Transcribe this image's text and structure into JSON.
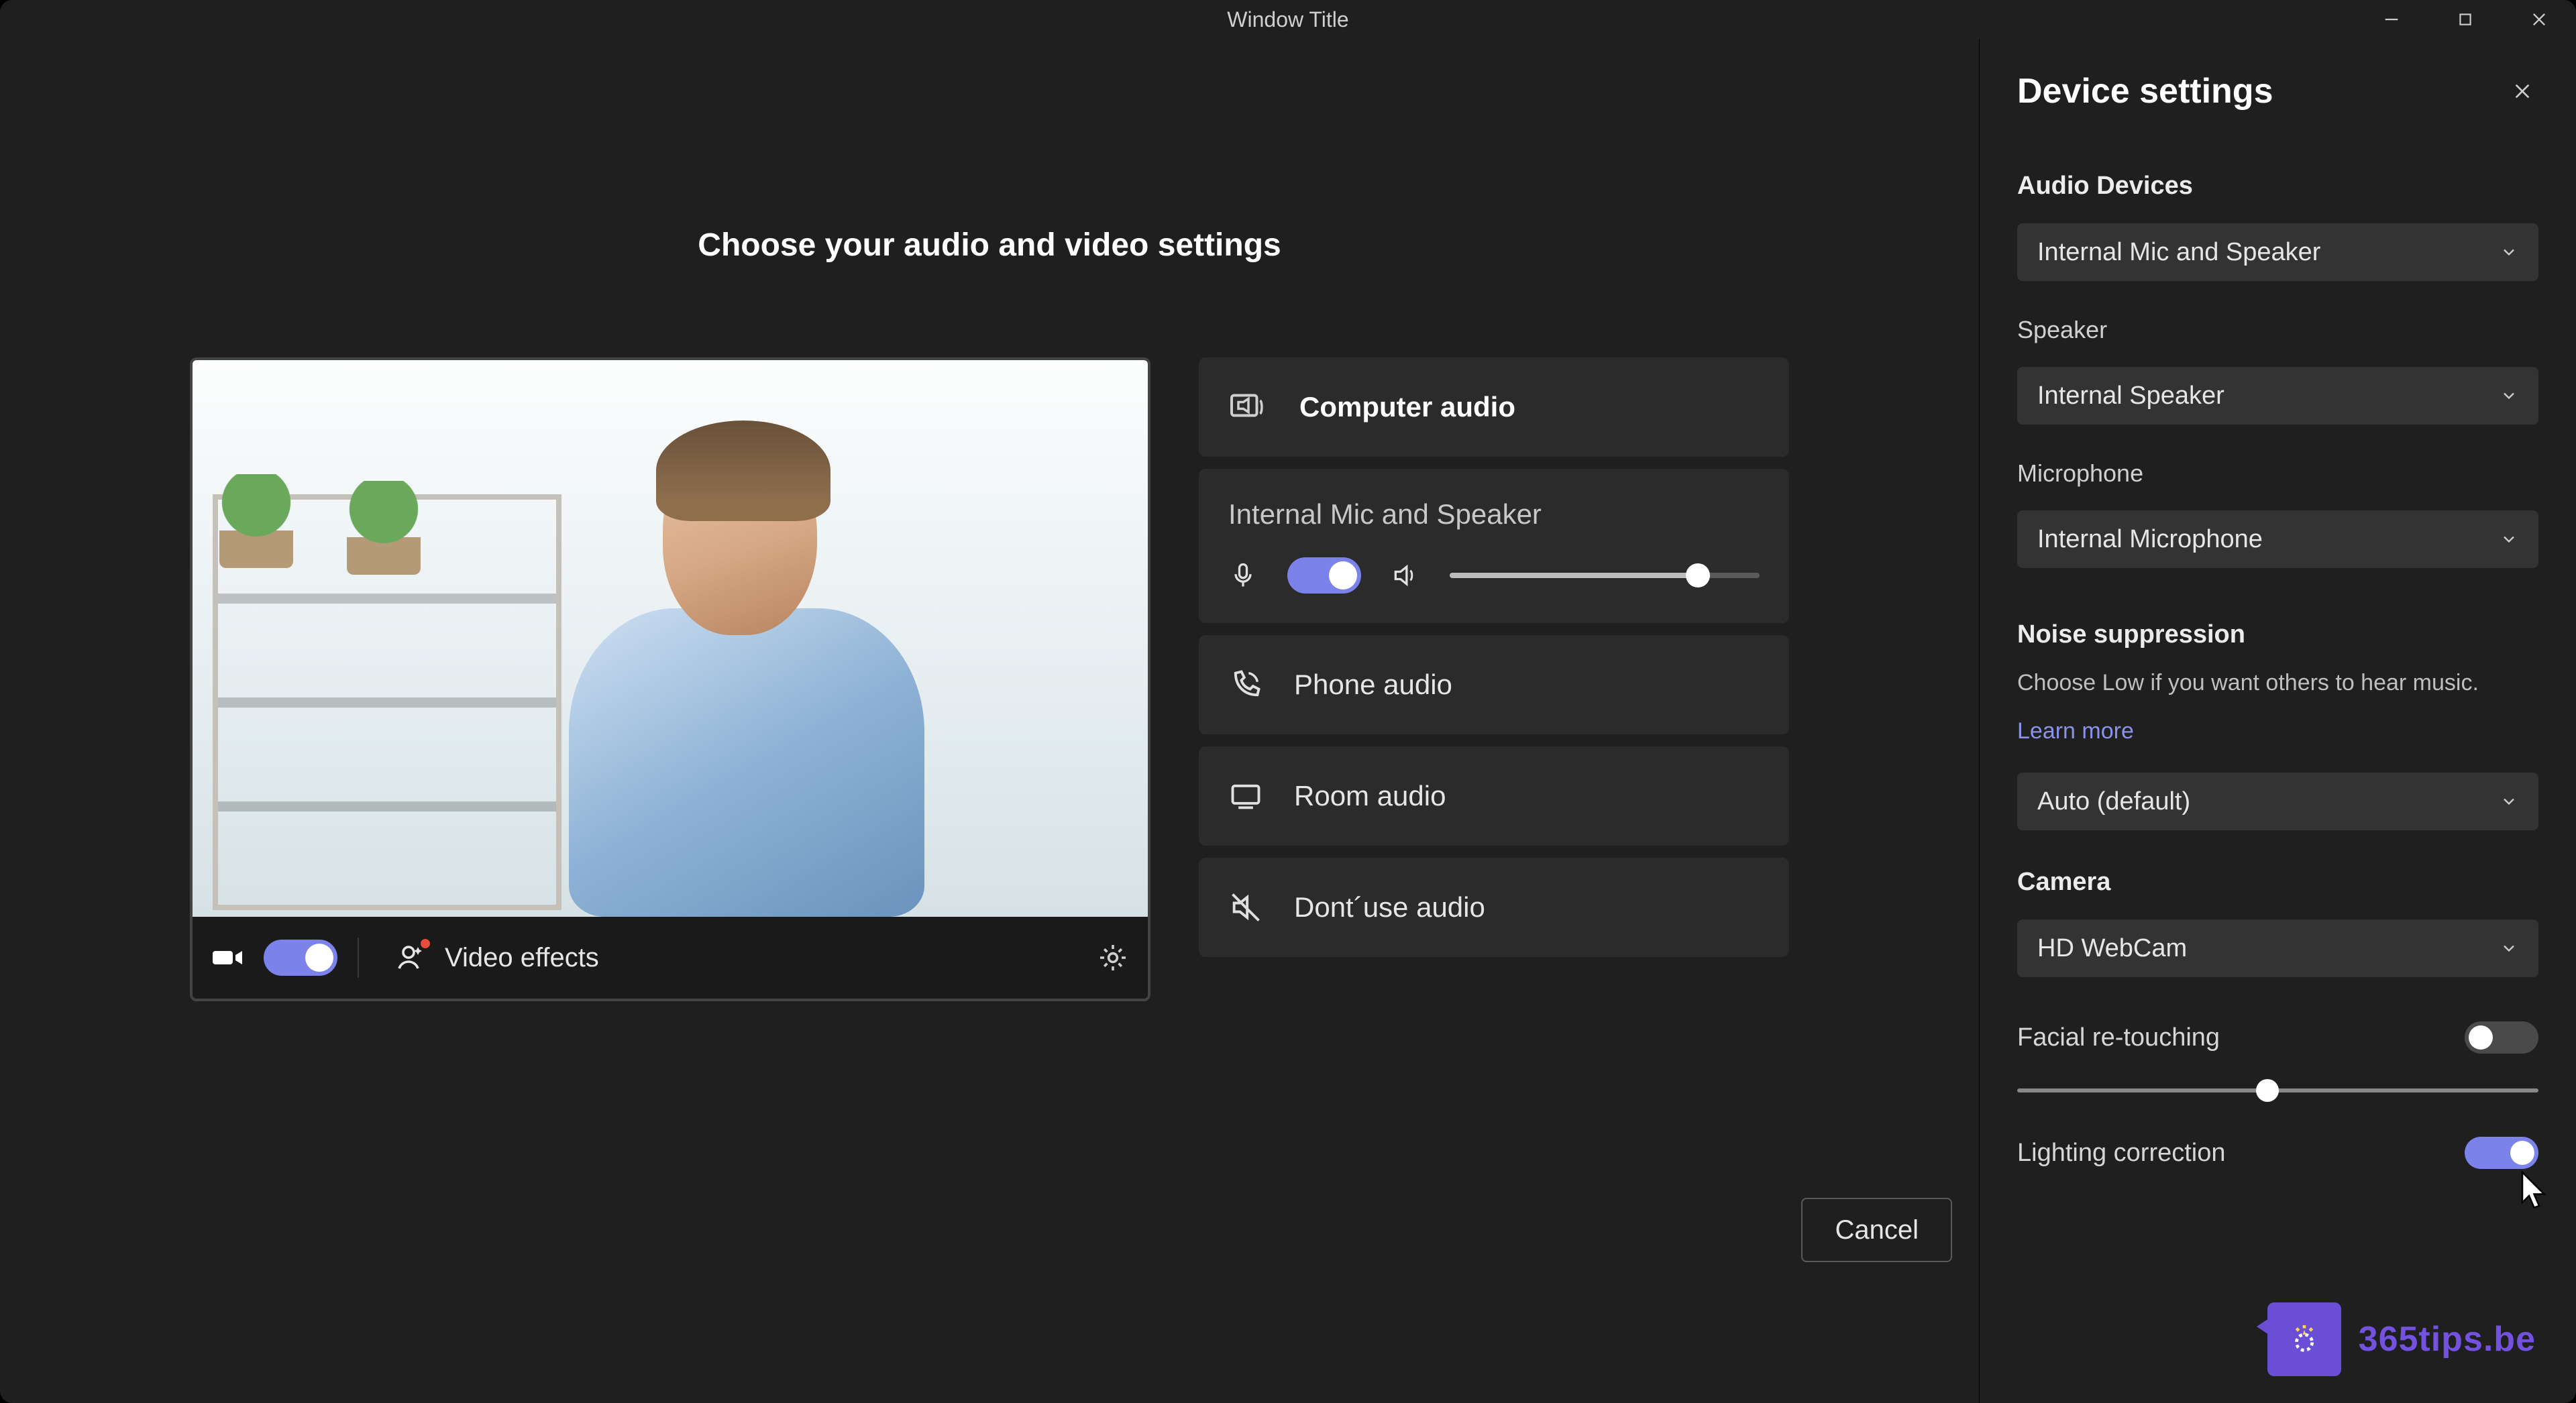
{
  "window": {
    "title": "Window Title"
  },
  "main": {
    "heading": "Choose your audio and video settings",
    "video_effects_label": "Video effects",
    "computer_audio_label": "Computer audio",
    "internal_mic_speaker_label": "Internal Mic and Speaker",
    "phone_audio_label": "Phone audio",
    "room_audio_label": "Room audio",
    "dont_use_audio_label": "Dont´use audio",
    "cancel_label": "Cancel",
    "speaker_volume_percent": 80,
    "camera_toggle_on": true,
    "mic_toggle_on": true
  },
  "panel": {
    "title": "Device settings",
    "audio_devices_label": "Audio Devices",
    "audio_devices_value": "Internal Mic and Speaker",
    "speaker_label": "Speaker",
    "speaker_value": "Internal Speaker",
    "microphone_label": "Microphone",
    "microphone_value": "Internal Microphone",
    "noise_label": "Noise suppression",
    "noise_help": "Choose Low if you want others to hear music.",
    "learn_more": "Learn more",
    "noise_value": "Auto (default)",
    "camera_label": "Camera",
    "camera_value": "HD WebCam",
    "facial_label": "Facial re-touching",
    "facial_toggle_on": false,
    "facial_slider_percent": 48,
    "lighting_label": "Lighting correction",
    "lighting_toggle_on": true
  },
  "watermark": {
    "text": "365tips.be"
  }
}
